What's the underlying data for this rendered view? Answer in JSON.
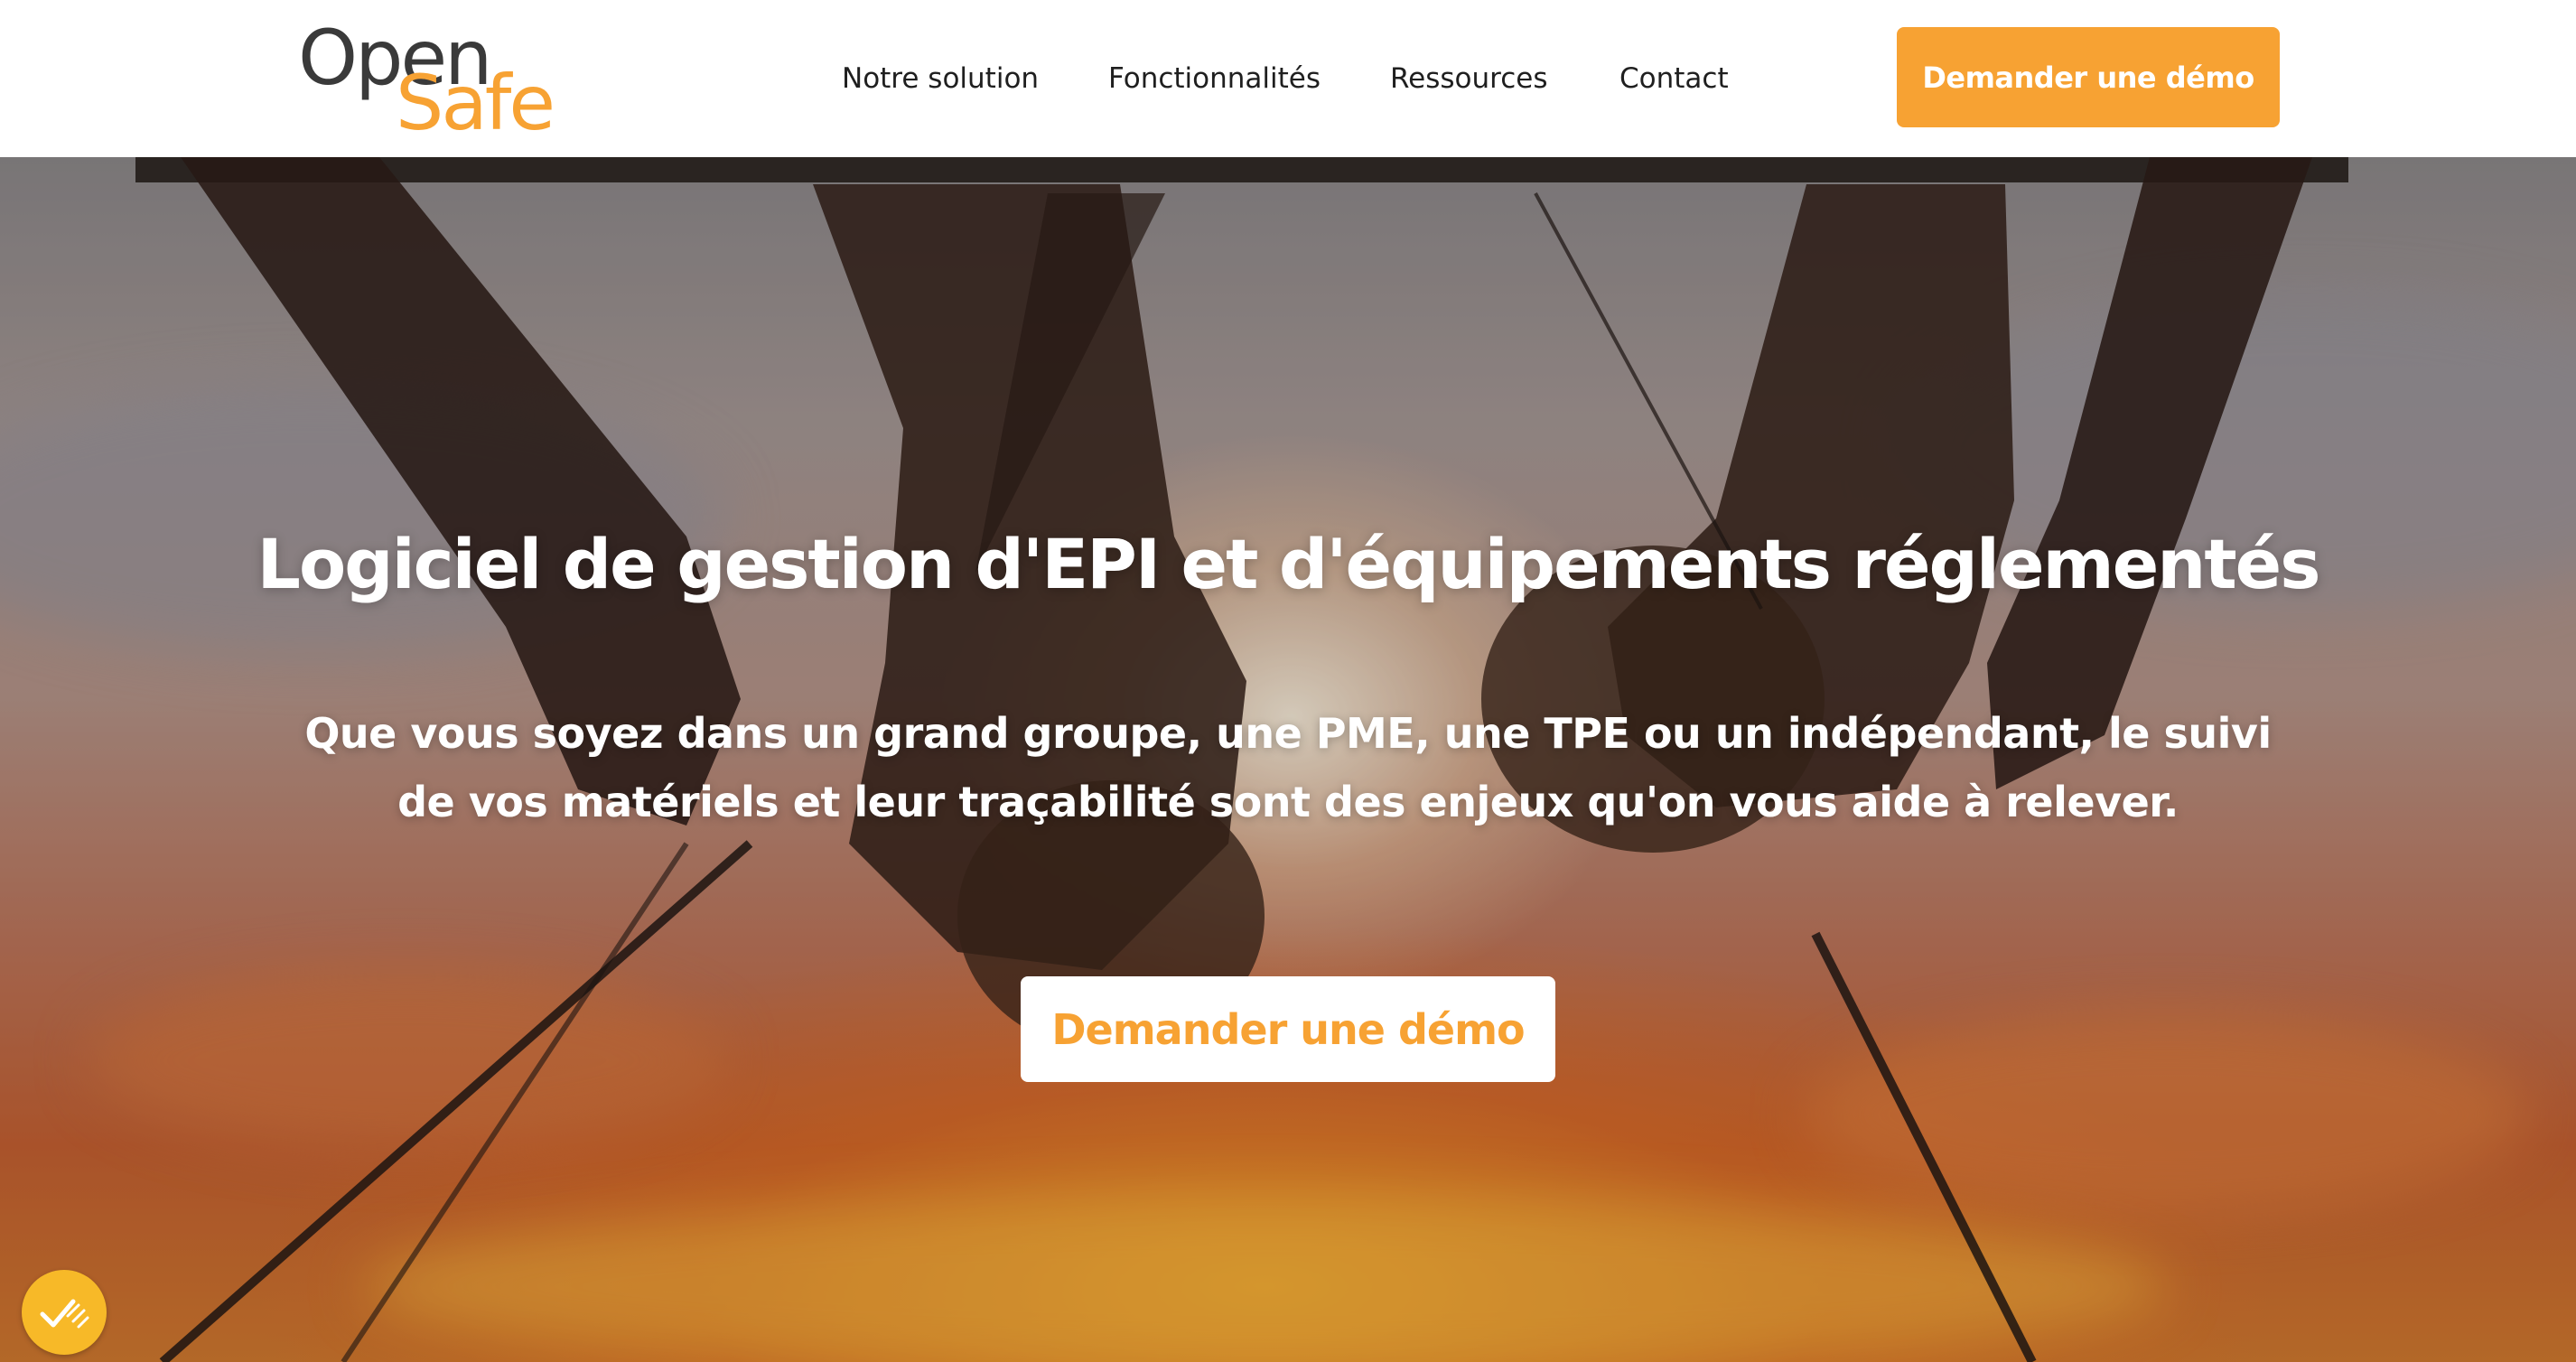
{
  "brand": {
    "logo_part1": "Open",
    "logo_part2": "Safe",
    "accent_color": "#f7a233",
    "dark_color": "#3a3a3a"
  },
  "nav": {
    "items": [
      {
        "label": "Notre solution"
      },
      {
        "label": "Fonctionnalités"
      },
      {
        "label": "Ressources"
      },
      {
        "label": "Contact"
      }
    ],
    "cta_label": "Demander une démo"
  },
  "hero": {
    "title": "Logiciel de gestion d'EPI et d'équipements réglementés",
    "subtitle": "Que vous soyez dans un grand groupe, une PME, une TPE ou un indépendant, le suivi de vos matériels et leur traçabilité sont des enjeux qu'on vous aide à relever.",
    "cta_label": "Demander une démo"
  },
  "cookie_badge": {
    "icon": "check-marks-icon",
    "color": "#f7b928"
  }
}
